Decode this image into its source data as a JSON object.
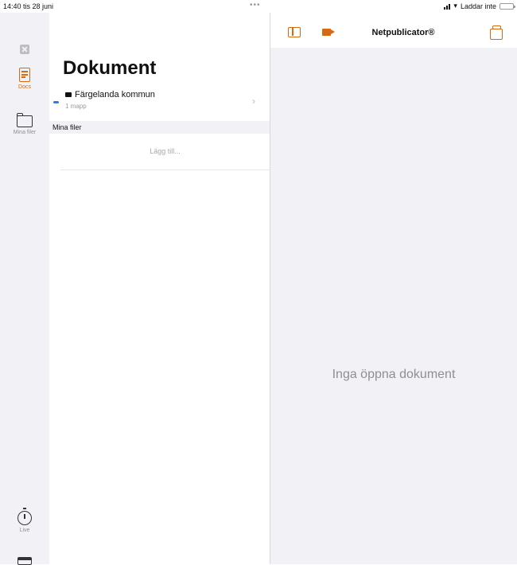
{
  "status_bar": {
    "time_date": "14:40  tis 28 juni",
    "dots": "•••",
    "network_status": "Laddar inte"
  },
  "rail": {
    "items": [
      {
        "label": "Docs",
        "icon": "document-icon",
        "active": true
      },
      {
        "label": "Mina filer",
        "icon": "folder-icon",
        "active": false
      },
      {
        "label": "Live",
        "icon": "timer-icon",
        "active": false
      }
    ]
  },
  "list": {
    "title": "Dokument",
    "organization": {
      "name": "Färgelanda kommun",
      "subtitle": "1 mapp"
    },
    "section_header": "Mina filer",
    "add_label": "Lägg till..."
  },
  "detail": {
    "toolbar_title": "Netpublicator®",
    "empty_message": "Inga öppna dokument"
  },
  "colors": {
    "accent": "#d56a12",
    "sidebar_bg": "#f2f2f6",
    "indicator_blue": "#2b7de9"
  }
}
